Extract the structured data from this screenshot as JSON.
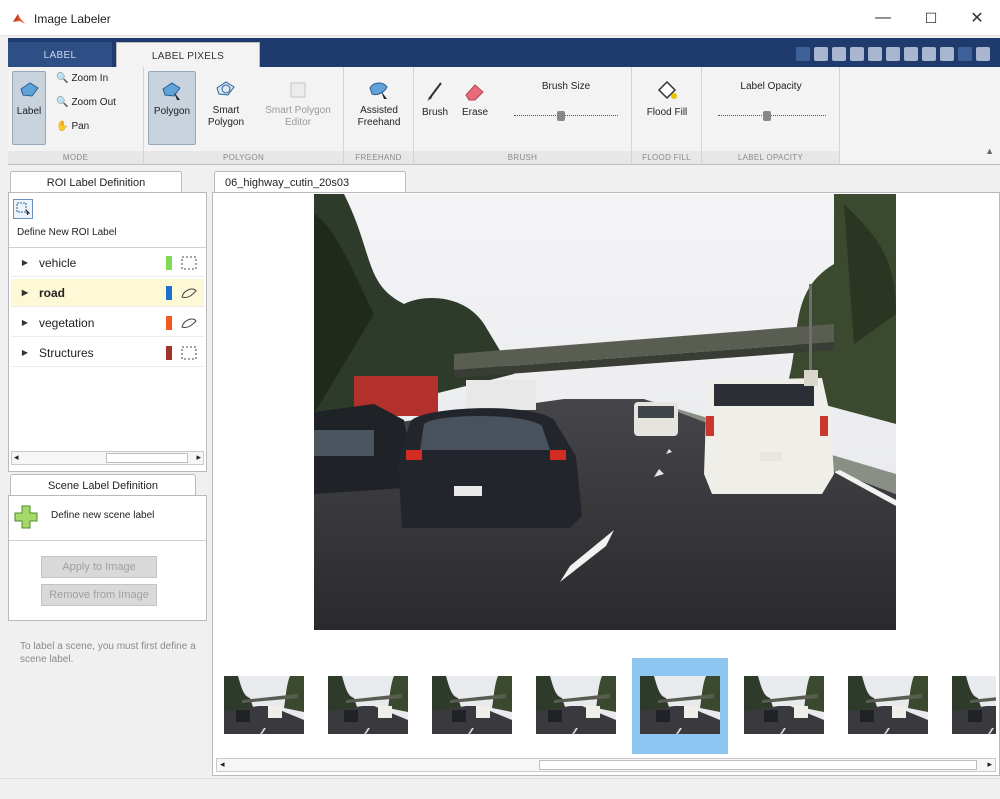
{
  "window": {
    "title": "Image Labeler",
    "minimize": "—",
    "maximize": "☐",
    "close": "✕"
  },
  "tabs": [
    {
      "label": "LABEL"
    },
    {
      "label": "LABEL PIXELS"
    }
  ],
  "ribbon": {
    "mode": {
      "section": "MODE",
      "label_btn": "Label",
      "zoom_in": "Zoom In",
      "zoom_out": "Zoom Out",
      "pan": "Pan"
    },
    "polygon": {
      "section": "POLYGON",
      "polygon": "Polygon",
      "smart_polygon_1": "Smart",
      "smart_polygon_2": "Polygon",
      "editor_1": "Smart Polygon",
      "editor_2": "Editor"
    },
    "freehand": {
      "section": "FREEHAND",
      "line1": "Assisted",
      "line2": "Freehand"
    },
    "brush": {
      "section": "BRUSH",
      "brush": "Brush",
      "erase": "Erase",
      "size_label": "Brush Size",
      "size_level": 0.45
    },
    "flood": {
      "section": "FLOOD FILL",
      "label": "Flood Fill"
    },
    "opacity": {
      "section": "LABEL OPACITY",
      "label": "Label Opacity",
      "level": 0.45
    }
  },
  "roi_panel": {
    "tab": "ROI Label Definition",
    "define_new": "Define New ROI Label",
    "labels": [
      {
        "name": "vehicle",
        "color": "#7ed957",
        "shape": "rect"
      },
      {
        "name": "road",
        "color": "#1f6fd1",
        "shape": "pixel"
      },
      {
        "name": "vegetation",
        "color": "#f05a22",
        "shape": "pixel"
      },
      {
        "name": "Structures",
        "color": "#a2332b",
        "shape": "rect"
      }
    ]
  },
  "scene_panel": {
    "tab": "Scene Label Definition",
    "define_new": "Define new scene label",
    "apply": "Apply to Image",
    "remove": "Remove from Image",
    "hint": "To label a scene, you must first define a scene label."
  },
  "document": {
    "tab": "06_highway_cutin_20s03"
  },
  "filmstrip": {
    "count": 8,
    "selected_index": 4
  },
  "colors": {
    "ribbon_dark": "#1f3b6e",
    "selection": "#8ec6f2",
    "selected_row": "#fdf8d6"
  }
}
